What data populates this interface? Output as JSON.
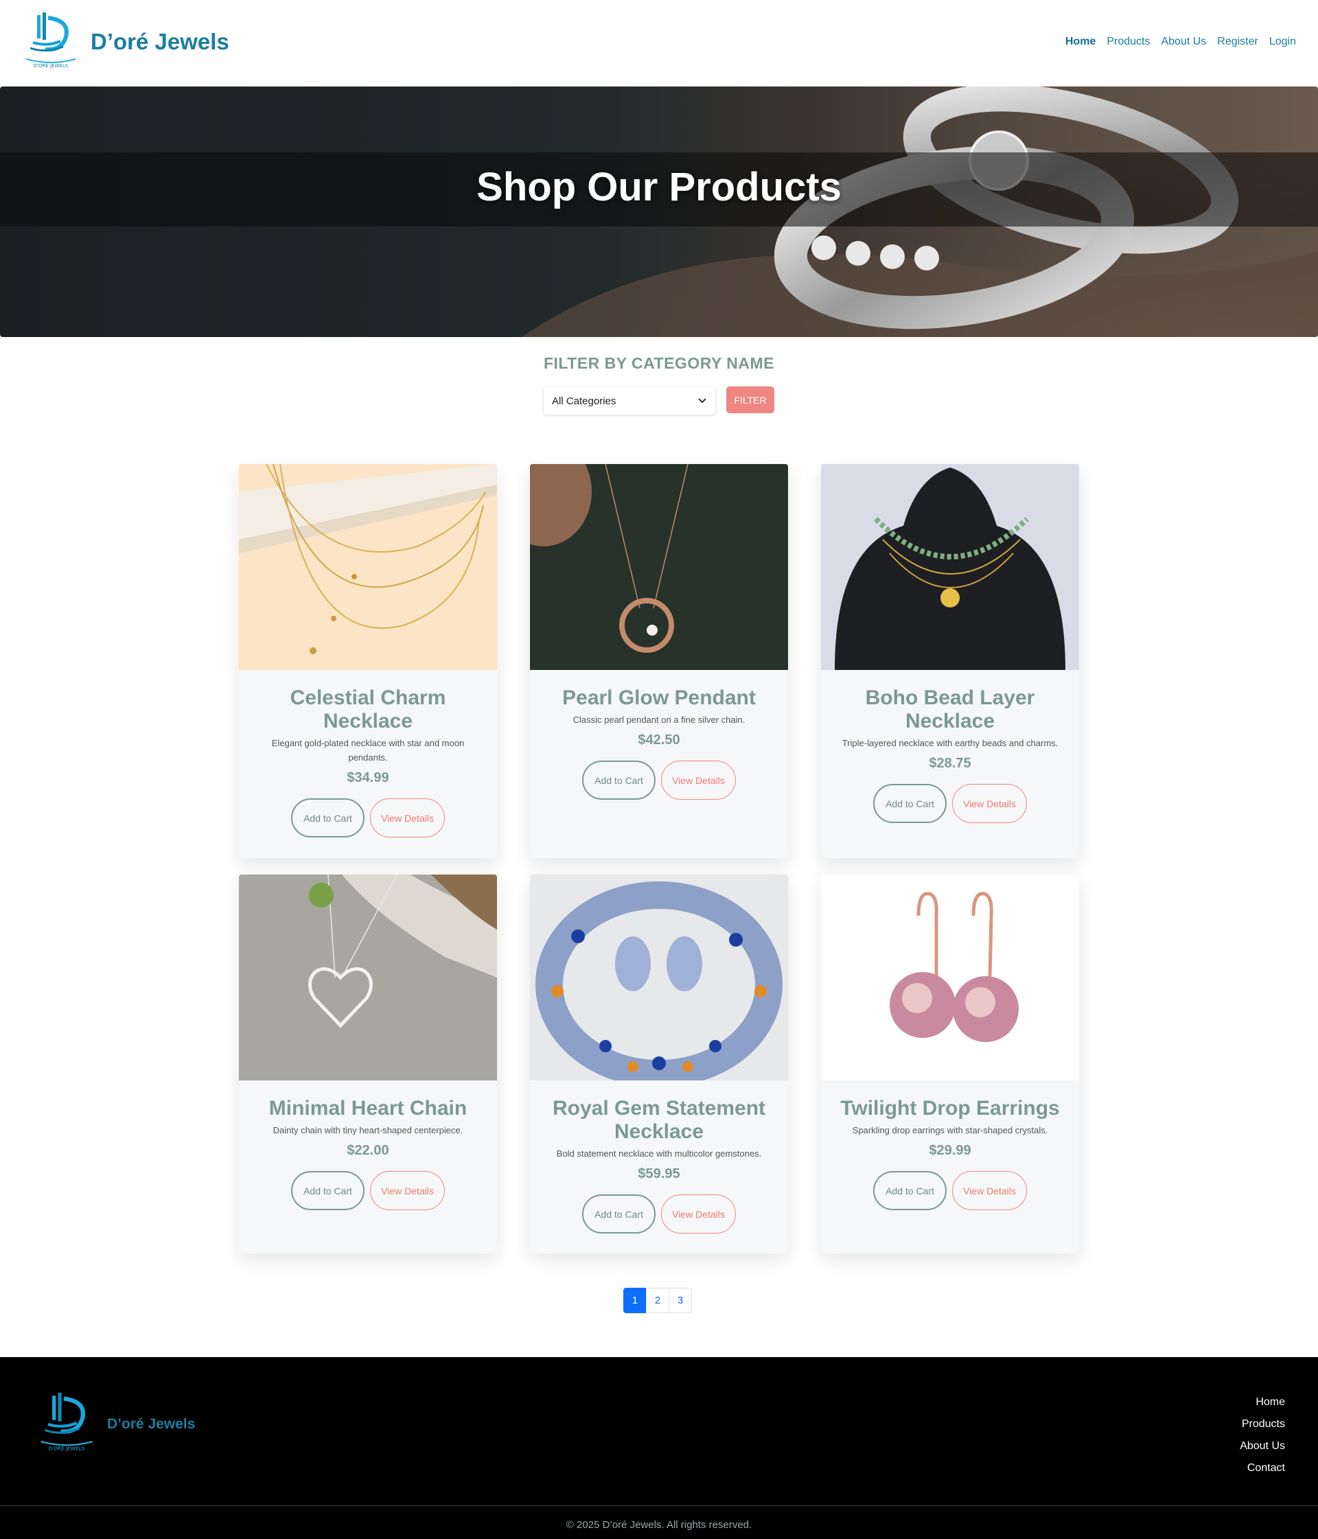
{
  "header": {
    "brand": "D’oré Jewels",
    "logo_icon": "dore-jewels-logo",
    "nav": [
      {
        "label": "Home",
        "active": true
      },
      {
        "label": "Products"
      },
      {
        "label": "About Us"
      },
      {
        "label": "Register"
      },
      {
        "label": "Login"
      }
    ]
  },
  "hero": {
    "title": "Shop Our Products",
    "image": "rings-on-leaf-photo"
  },
  "filter": {
    "title": "FILTER BY CATEGORY NAME",
    "selected": "All Categories",
    "button": "FILTER"
  },
  "products": [
    {
      "name": "Celestial Charm Necklace",
      "desc": "Elegant gold-plated necklace with star and moon pendants.",
      "price": "$34.99",
      "add_label": "Add to Cart",
      "view_label": "View Details",
      "image": "gold-layered-necklace-photo"
    },
    {
      "name": "Pearl Glow Pendant",
      "desc": "Classic pearl pendant on a fine silver chain.",
      "price": "$42.50",
      "add_label": "Add to Cart",
      "view_label": "View Details",
      "image": "rose-gold-pearl-pendant-photo"
    },
    {
      "name": "Boho Bead Layer Necklace",
      "desc": "Triple-layered necklace with earthy beads and charms.",
      "price": "$28.75",
      "add_label": "Add to Cart",
      "view_label": "View Details",
      "image": "boho-bead-necklace-on-bust-photo"
    },
    {
      "name": "Minimal Heart Chain",
      "desc": "Dainty chain with tiny heart-shaped centerpiece.",
      "price": "$22.00",
      "add_label": "Add to Cart",
      "view_label": "View Details",
      "image": "silver-heart-chain-photo"
    },
    {
      "name": "Royal Gem Statement Necklace",
      "desc": "Bold statement necklace with multicolor gemstones.",
      "price": "$59.95",
      "add_label": "Add to Cart",
      "view_label": "View Details",
      "image": "gemstone-statement-necklace-photo"
    },
    {
      "name": "Twilight Drop Earrings",
      "desc": "Sparkling drop earrings with star-shaped crystals.",
      "price": "$29.99",
      "add_label": "Add to Cart",
      "view_label": "View Details",
      "image": "pearl-drop-earrings-photo"
    }
  ],
  "pagination": {
    "pages": [
      "1",
      "2",
      "3"
    ],
    "current": "1"
  },
  "footer": {
    "brand": "D’oré Jewels",
    "links": [
      "Home",
      "Products",
      "About Us",
      "Contact"
    ],
    "copyright": "© 2025 D’oré Jewels. All rights reserved."
  },
  "colors": {
    "brand": "#1a7ea0",
    "sage": "#7a9a90",
    "coral": "#ef8680",
    "page_link": "#0d6efd"
  }
}
